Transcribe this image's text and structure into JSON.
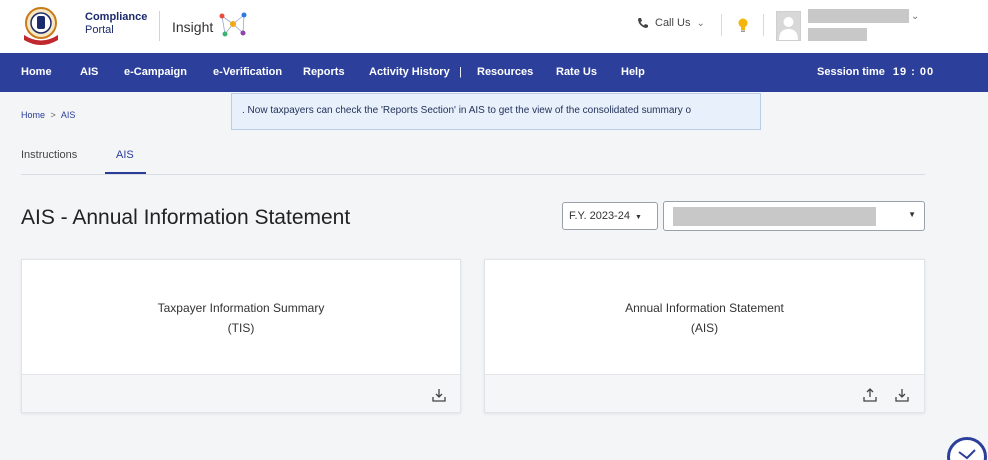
{
  "header": {
    "brand_line1": "Compliance",
    "brand_line2": "Portal",
    "insight_label": "Insight",
    "call_us": "Call Us"
  },
  "nav": {
    "items": [
      "Home",
      "AIS",
      "e-Campaign",
      "e-Verification",
      "Reports",
      "Activity History",
      "Resources",
      "Rate Us",
      "Help"
    ],
    "separator": "|",
    "session_label": "Session time",
    "session_time": "19 : 00"
  },
  "announcement": ". Now taxpayers can check the 'Reports Section' in AIS to get the view of the consolidated summary o",
  "breadcrumb": {
    "home": "Home",
    "sep": ">",
    "current": "AIS"
  },
  "tabs": [
    "Instructions",
    "AIS"
  ],
  "page_title": "AIS - Annual Information Statement",
  "fy_select": "F.Y. 2023-24",
  "cards": [
    {
      "line1": "Taxpayer Information Summary",
      "line2": "(TIS)"
    },
    {
      "line1": "Annual Information Statement",
      "line2": "(AIS)"
    }
  ],
  "colors": {
    "nav_bg": "#2c3f9b",
    "accent": "#2a3c9a",
    "announce_bg": "#e8f0fb"
  },
  "icons": [
    "phone-icon",
    "bulb-icon",
    "download-icon",
    "upload-icon",
    "chat-bot-icon"
  ]
}
